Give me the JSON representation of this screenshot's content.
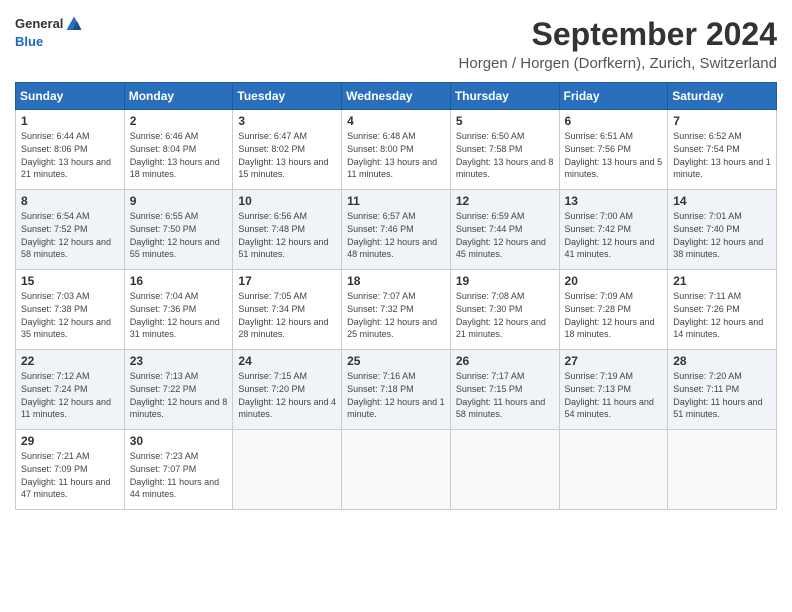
{
  "header": {
    "logo_general": "General",
    "logo_blue": "Blue",
    "title": "September 2024",
    "subtitle": "Horgen / Horgen (Dorfkern), Zurich, Switzerland"
  },
  "weekdays": [
    "Sunday",
    "Monday",
    "Tuesday",
    "Wednesday",
    "Thursday",
    "Friday",
    "Saturday"
  ],
  "weeks": [
    [
      {
        "day": "1",
        "sunrise": "6:44 AM",
        "sunset": "8:06 PM",
        "daylight": "13 hours and 21 minutes."
      },
      {
        "day": "2",
        "sunrise": "6:46 AM",
        "sunset": "8:04 PM",
        "daylight": "13 hours and 18 minutes."
      },
      {
        "day": "3",
        "sunrise": "6:47 AM",
        "sunset": "8:02 PM",
        "daylight": "13 hours and 15 minutes."
      },
      {
        "day": "4",
        "sunrise": "6:48 AM",
        "sunset": "8:00 PM",
        "daylight": "13 hours and 11 minutes."
      },
      {
        "day": "5",
        "sunrise": "6:50 AM",
        "sunset": "7:58 PM",
        "daylight": "13 hours and 8 minutes."
      },
      {
        "day": "6",
        "sunrise": "6:51 AM",
        "sunset": "7:56 PM",
        "daylight": "13 hours and 5 minutes."
      },
      {
        "day": "7",
        "sunrise": "6:52 AM",
        "sunset": "7:54 PM",
        "daylight": "13 hours and 1 minute."
      }
    ],
    [
      {
        "day": "8",
        "sunrise": "6:54 AM",
        "sunset": "7:52 PM",
        "daylight": "12 hours and 58 minutes."
      },
      {
        "day": "9",
        "sunrise": "6:55 AM",
        "sunset": "7:50 PM",
        "daylight": "12 hours and 55 minutes."
      },
      {
        "day": "10",
        "sunrise": "6:56 AM",
        "sunset": "7:48 PM",
        "daylight": "12 hours and 51 minutes."
      },
      {
        "day": "11",
        "sunrise": "6:57 AM",
        "sunset": "7:46 PM",
        "daylight": "12 hours and 48 minutes."
      },
      {
        "day": "12",
        "sunrise": "6:59 AM",
        "sunset": "7:44 PM",
        "daylight": "12 hours and 45 minutes."
      },
      {
        "day": "13",
        "sunrise": "7:00 AM",
        "sunset": "7:42 PM",
        "daylight": "12 hours and 41 minutes."
      },
      {
        "day": "14",
        "sunrise": "7:01 AM",
        "sunset": "7:40 PM",
        "daylight": "12 hours and 38 minutes."
      }
    ],
    [
      {
        "day": "15",
        "sunrise": "7:03 AM",
        "sunset": "7:38 PM",
        "daylight": "12 hours and 35 minutes."
      },
      {
        "day": "16",
        "sunrise": "7:04 AM",
        "sunset": "7:36 PM",
        "daylight": "12 hours and 31 minutes."
      },
      {
        "day": "17",
        "sunrise": "7:05 AM",
        "sunset": "7:34 PM",
        "daylight": "12 hours and 28 minutes."
      },
      {
        "day": "18",
        "sunrise": "7:07 AM",
        "sunset": "7:32 PM",
        "daylight": "12 hours and 25 minutes."
      },
      {
        "day": "19",
        "sunrise": "7:08 AM",
        "sunset": "7:30 PM",
        "daylight": "12 hours and 21 minutes."
      },
      {
        "day": "20",
        "sunrise": "7:09 AM",
        "sunset": "7:28 PM",
        "daylight": "12 hours and 18 minutes."
      },
      {
        "day": "21",
        "sunrise": "7:11 AM",
        "sunset": "7:26 PM",
        "daylight": "12 hours and 14 minutes."
      }
    ],
    [
      {
        "day": "22",
        "sunrise": "7:12 AM",
        "sunset": "7:24 PM",
        "daylight": "12 hours and 11 minutes."
      },
      {
        "day": "23",
        "sunrise": "7:13 AM",
        "sunset": "7:22 PM",
        "daylight": "12 hours and 8 minutes."
      },
      {
        "day": "24",
        "sunrise": "7:15 AM",
        "sunset": "7:20 PM",
        "daylight": "12 hours and 4 minutes."
      },
      {
        "day": "25",
        "sunrise": "7:16 AM",
        "sunset": "7:18 PM",
        "daylight": "12 hours and 1 minute."
      },
      {
        "day": "26",
        "sunrise": "7:17 AM",
        "sunset": "7:15 PM",
        "daylight": "11 hours and 58 minutes."
      },
      {
        "day": "27",
        "sunrise": "7:19 AM",
        "sunset": "7:13 PM",
        "daylight": "11 hours and 54 minutes."
      },
      {
        "day": "28",
        "sunrise": "7:20 AM",
        "sunset": "7:11 PM",
        "daylight": "11 hours and 51 minutes."
      }
    ],
    [
      {
        "day": "29",
        "sunrise": "7:21 AM",
        "sunset": "7:09 PM",
        "daylight": "11 hours and 47 minutes."
      },
      {
        "day": "30",
        "sunrise": "7:23 AM",
        "sunset": "7:07 PM",
        "daylight": "11 hours and 44 minutes."
      },
      null,
      null,
      null,
      null,
      null
    ]
  ]
}
